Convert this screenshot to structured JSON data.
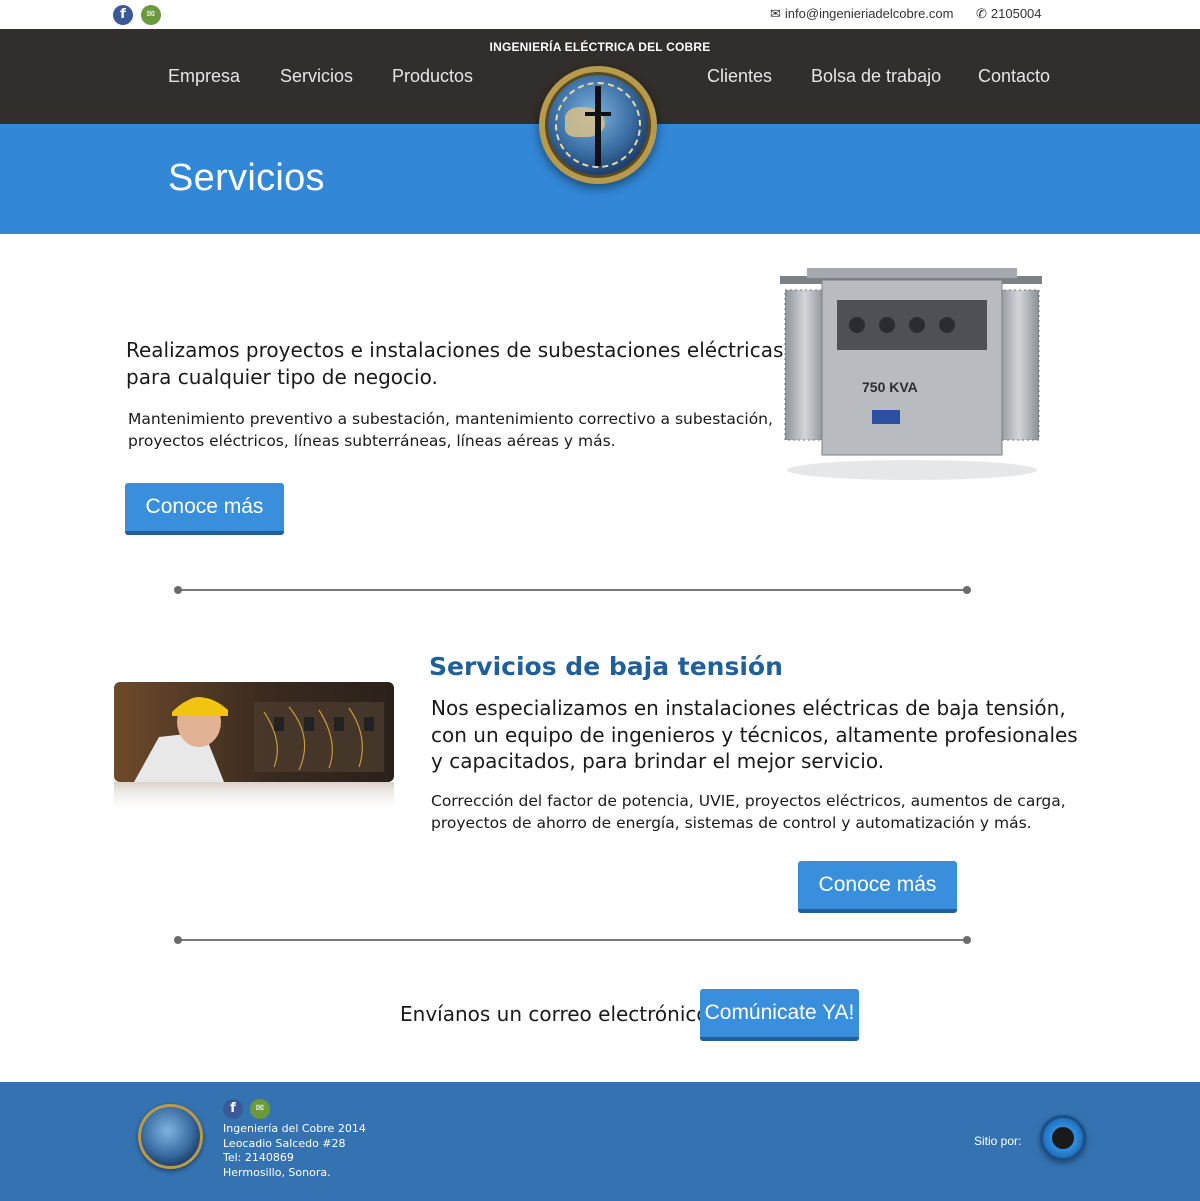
{
  "topbar": {
    "facebook_icon": "facebook-icon",
    "mail_icon": "mail-icon",
    "email": "info@ingenieriadelcobre.com",
    "phone": "2105004"
  },
  "header": {
    "brand": "INGENIERÍA ELÉCTRICA DEL COBRE",
    "nav": [
      "Empresa",
      "Servicios",
      "Productos",
      "Clientes",
      "Bolsa de trabajo",
      "Contacto"
    ]
  },
  "banner": {
    "title": "Servicios"
  },
  "section1": {
    "lead_line1": "Realizamos proyectos e instalaciones de subestaciones eléctricas",
    "lead_line2": "para cualquier tipo de negocio.",
    "body_line1": "Mantenimiento preventivo a subestación, mantenimiento correctivo a subestación,",
    "body_line2": "proyectos eléctricos, líneas subterráneas, líneas aéreas y más.",
    "button": "Conoce más",
    "image_label": "750 KVA"
  },
  "section2": {
    "title": "Servicios de baja tensión",
    "lead_line1": "Nos especializamos en instalaciones eléctricas de baja tensión,",
    "lead_line2": "con un equipo de ingenieros y técnicos, altamente profesionales",
    "lead_line3": "y capacitados, para brindar el mejor servicio.",
    "body_line1": "Corrección del factor de potencia, UVIE, proyectos eléctricos, aumentos de carga,",
    "body_line2": "proyectos de ahorro de energía, sistemas de control y automatización y más.",
    "button": "Conoce más"
  },
  "cta": {
    "text": "Envíanos un correo electrónico",
    "button": "Comúnicate YA!"
  },
  "footer": {
    "line1": "Ingeniería del Cobre 2014",
    "line2": "Leocadio Salcedo #28",
    "line3": "Tel: 2140869",
    "line4": "Hermosillo, Sonora.",
    "credit": "Sitio por:"
  },
  "colors": {
    "header_bg": "#312e2c",
    "banner_bg": "#3287d7",
    "button": "#3a8fdc",
    "title_blue": "#1f5f9c",
    "footer_bg": "#3472b1"
  }
}
